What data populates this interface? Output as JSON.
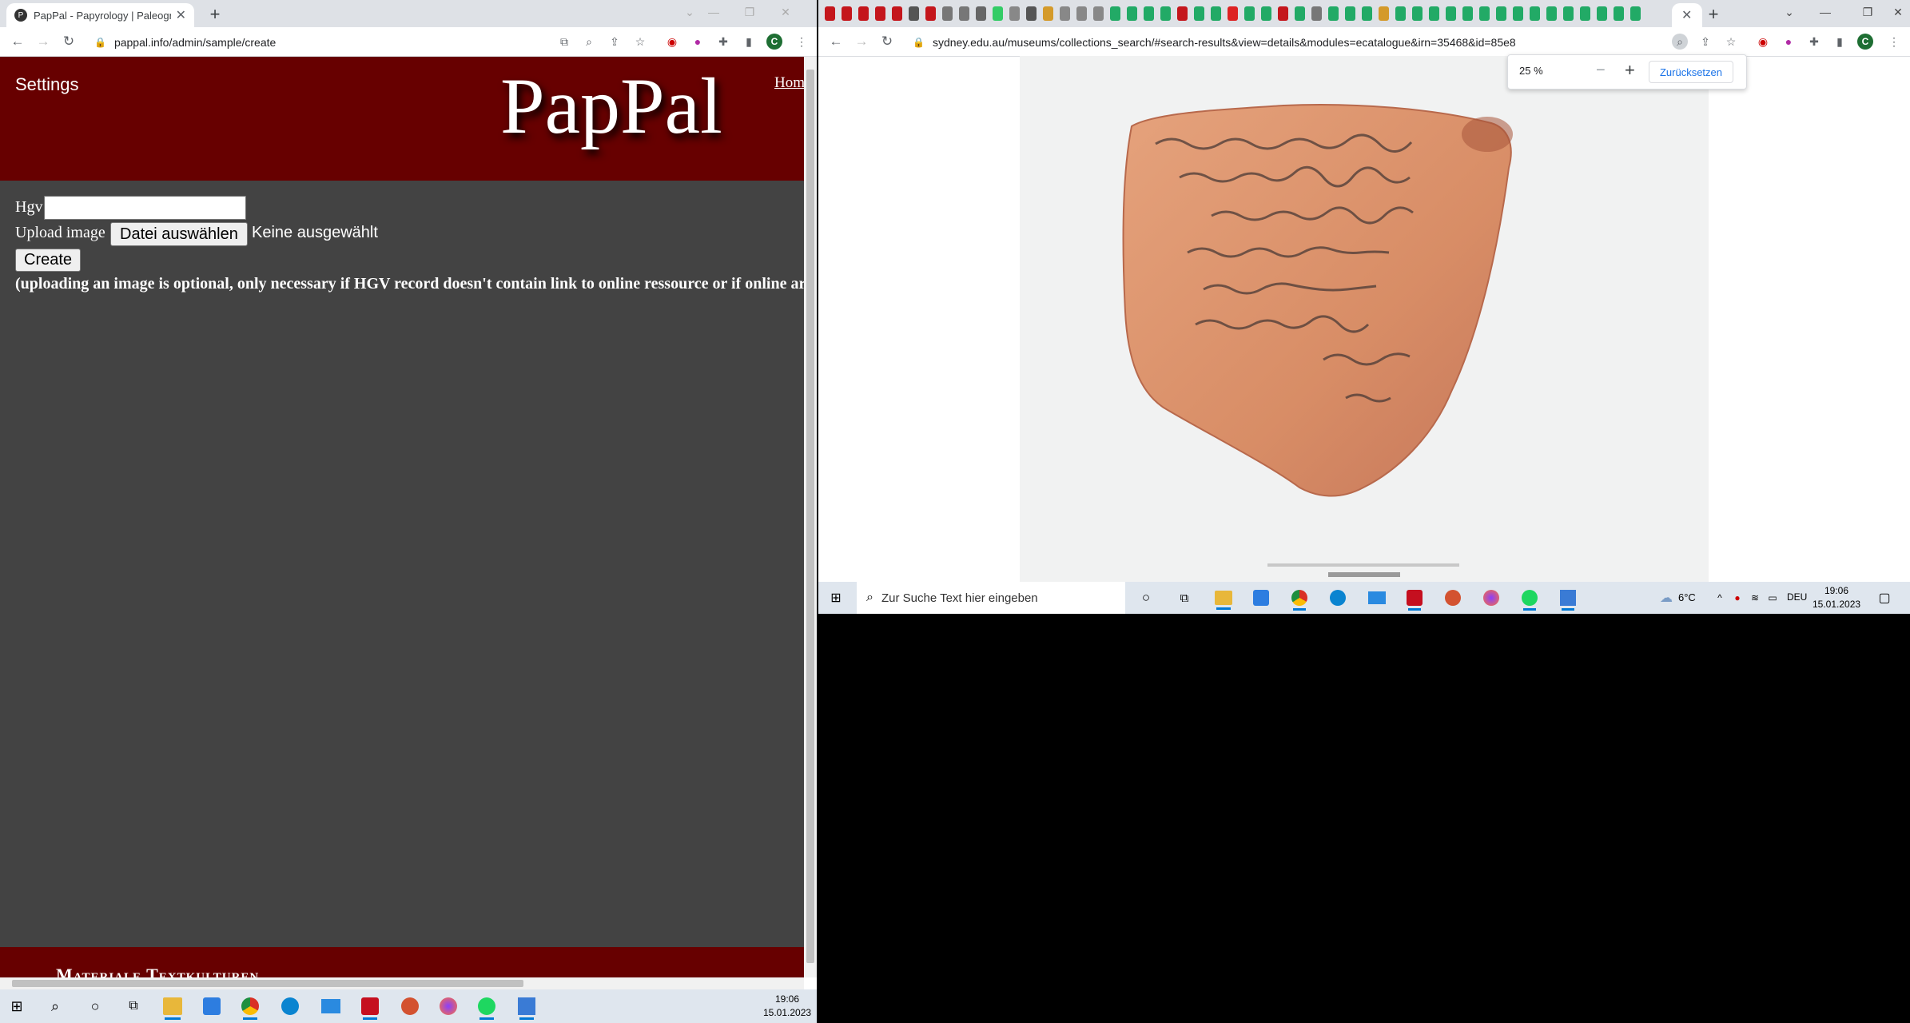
{
  "left_browser": {
    "tab": {
      "title": "PapPal - Papyrology | Paleograph",
      "favicon": "P"
    },
    "url": "pappal.info/admin/sample/create",
    "profile_initial": "C",
    "page": {
      "settings_label": "Settings",
      "logo": "PapPal",
      "home_link": "Hom",
      "hgv_label": "Hgv",
      "hgv_value": "",
      "upload_label": "Upload image",
      "file_button": "Datei auswählen",
      "file_status": "Keine ausgewählt",
      "create_button": "Create",
      "note": "(uploading an image is optional, only necessary if HGV record doesn't contain link to online ressource or if online arc",
      "footer_text": "Materiale Textkulturen"
    },
    "colors": {
      "banner": "#670000",
      "page_bg": "#434343"
    }
  },
  "right_browser": {
    "url": "sydney.edu.au/museums/collections_search/#search-results&view=details&modules=ecatalogue&irn=35468&id=85e8",
    "profile_initial": "C",
    "zoom_popup": {
      "value": "25 %",
      "minus": "−",
      "plus": "+",
      "reset_label": "Zurücksetzen"
    },
    "image": {
      "subject": "ostracon with Greek handwriting"
    }
  },
  "right_taskbar": {
    "search_placeholder": "Zur Suche Text hier eingeben",
    "weather": "6°C",
    "language": "DEU",
    "time": "19:06",
    "date": "15.01.2023"
  },
  "left_taskbar": {
    "time": "19:06",
    "date": "15.01.2023"
  }
}
